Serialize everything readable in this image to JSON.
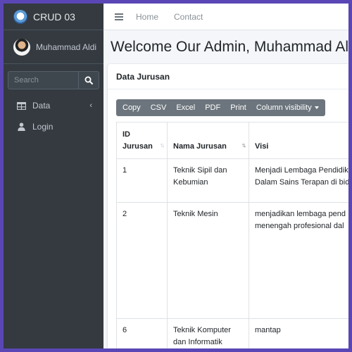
{
  "sidebar": {
    "brand": "CRUD 03",
    "user_name": "Muhammad Aldi",
    "search_placeholder": "Search",
    "items": [
      {
        "label": "Data",
        "icon": "table-icon",
        "caret": "‹"
      },
      {
        "label": "Login",
        "icon": "user-icon"
      }
    ]
  },
  "topbar": {
    "links": [
      "Home",
      "Contact"
    ]
  },
  "page": {
    "title": "Welcome Our Admin, Muhammad Al"
  },
  "card": {
    "title": "Data Jurusan",
    "buttons": [
      "Copy",
      "CSV",
      "Excel",
      "PDF",
      "Print",
      "Column visibility"
    ]
  },
  "table": {
    "headers": [
      "ID\nJurusan",
      "Nama Jurusan",
      "Visi"
    ],
    "rows": [
      {
        "id": "1",
        "nama": "Teknik Sipil dan Kebumian",
        "visi_lines": [
          "Menjadi Lembaga Pendidik",
          "Dalam Sains Terapan di bid"
        ]
      },
      {
        "id": "2",
        "nama": "Teknik Mesin",
        "visi_lines": [
          "menjadikan lembaga pend",
          "menengah profesional dal"
        ]
      },
      {
        "id": "6",
        "nama": "Teknik Komputer dan Informatik",
        "visi_lines": [
          "mantap"
        ]
      }
    ]
  },
  "colors": {
    "frame": "#5a46b5",
    "sidebar": "#343a40",
    "button_group": "#6c757d"
  }
}
